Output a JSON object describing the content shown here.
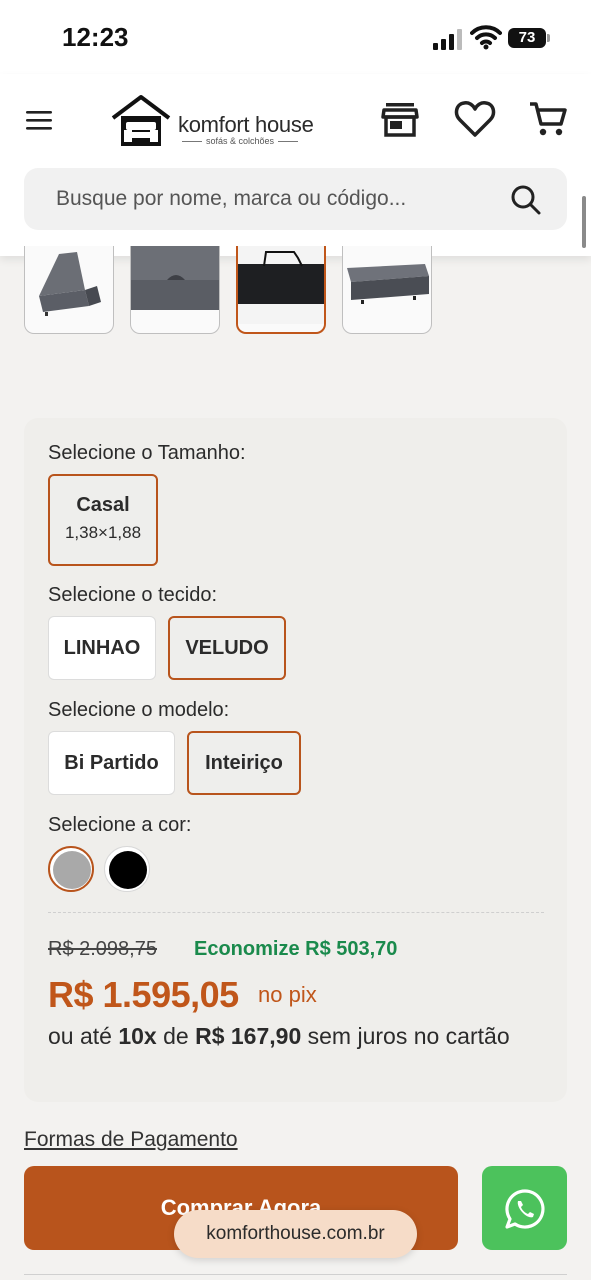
{
  "status": {
    "time": "12:23",
    "battery": "73"
  },
  "header": {
    "brand": "komfort house",
    "brand_sub": "sofás & colchões",
    "search_placeholder": "Busque por nome, marca ou código..."
  },
  "options": {
    "size_label": "Selecione o Tamanho:",
    "size_options": [
      {
        "name": "Casal",
        "dims": "1,38×1,88"
      }
    ],
    "fabric_label": "Selecione o tecido:",
    "fabric_options": [
      "LINHAO",
      "VELUDO"
    ],
    "model_label": "Selecione o modelo:",
    "model_options": [
      "Bi Partido",
      "Inteiriço"
    ],
    "color_label": "Selecione a cor:",
    "colors": [
      "#a9a9a9",
      "#000000"
    ]
  },
  "pricing": {
    "old_price": "R$ 2.098,75",
    "savings": "Economize R$ 503,70",
    "price": "R$ 1.595,05",
    "pix": "no pix",
    "inst_prefix": "ou até",
    "inst_count": "10x",
    "inst_mid": "de",
    "inst_value": "R$ 167,90",
    "inst_suffix": "sem juros no cartão"
  },
  "payment_link": "Formas de Pagamento",
  "buy_button": "Comprar Agora",
  "url": "komforthouse.com.br",
  "theme": {
    "accent": "#b8541c",
    "green": "#1a8a4c",
    "whatsapp": "#4cc25c"
  }
}
